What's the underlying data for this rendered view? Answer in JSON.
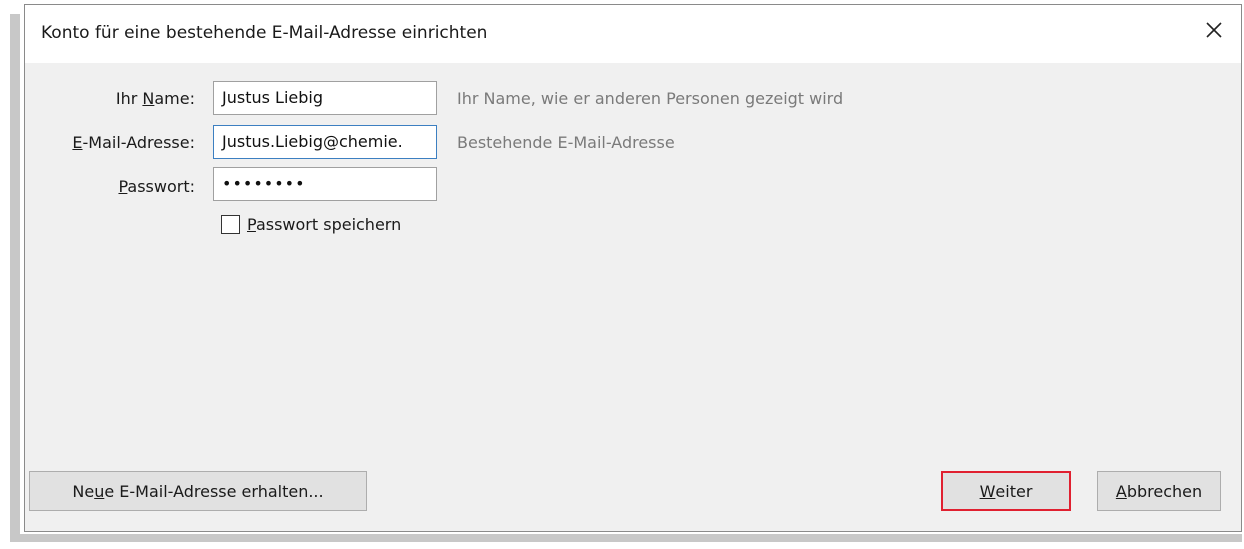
{
  "dialog": {
    "title": "Konto für eine bestehende E-Mail-Adresse einrichten",
    "close_icon": "close-icon"
  },
  "form": {
    "name": {
      "label_pre": "Ihr ",
      "label_accel": "N",
      "label_post": "ame:",
      "value": "Justus Liebig",
      "hint": "Ihr Name, wie er anderen Personen gezeigt wird"
    },
    "email": {
      "label_pre": "",
      "label_accel": "E",
      "label_post": "-Mail-Adresse:",
      "value": "Justus.Liebig@chemie.",
      "hint": "Bestehende E-Mail-Adresse"
    },
    "password": {
      "label_pre": "",
      "label_accel": "P",
      "label_post": "asswort:",
      "value": "••••••••"
    },
    "save_password": {
      "label_pre": "",
      "label_accel": "P",
      "label_post": "asswort speichern",
      "checked": false
    }
  },
  "buttons": {
    "new_address": {
      "label_pre": "Ne",
      "label_accel": "u",
      "label_post": "e E-Mail-Adresse erhalten..."
    },
    "next": {
      "label_pre": "",
      "label_accel": "W",
      "label_post": "eiter"
    },
    "cancel": {
      "label_pre": "",
      "label_accel": "A",
      "label_post": "bbrechen"
    }
  },
  "colors": {
    "highlight_border": "#e02030",
    "focus_border": "#3c7fc1"
  }
}
